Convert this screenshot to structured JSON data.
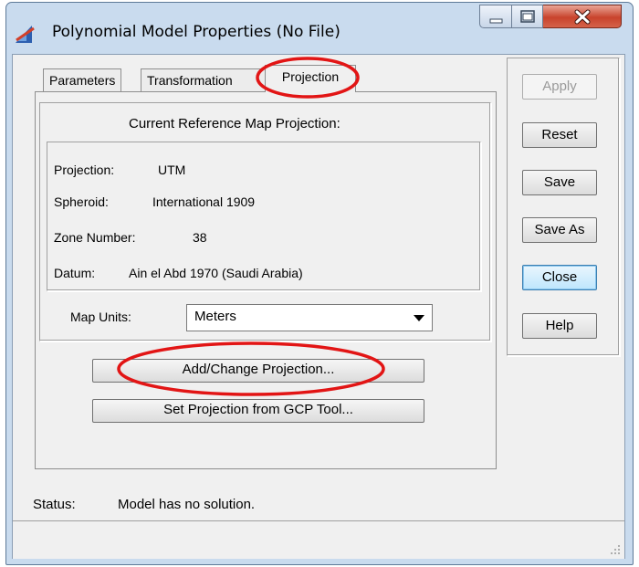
{
  "window": {
    "title": "Polynomial Model Properties (No File)",
    "accent": "#c9dbee",
    "close_color": "#c8432c",
    "annotation_color": "#e21515"
  },
  "tabs": [
    {
      "label": "Parameters"
    },
    {
      "label": "Transformation"
    },
    {
      "label": "Projection",
      "active": true
    }
  ],
  "projection": {
    "heading": "Current Reference Map Projection:",
    "projection_label": "Projection:",
    "projection_value": "UTM",
    "spheroid_label": "Spheroid:",
    "spheroid_value": "International 1909",
    "zone_label": "Zone Number:",
    "zone_value": "38",
    "datum_label": "Datum:",
    "datum_value": "Ain el Abd 1970 (Saudi Arabia)",
    "map_units_label": "Map Units:",
    "map_units_value": "Meters",
    "add_change_button": "Add/Change Projection...",
    "set_from_gcp_button": "Set Projection from GCP Tool..."
  },
  "side_buttons": {
    "apply": "Apply",
    "reset": "Reset",
    "save": "Save",
    "save_as": "Save As",
    "close": "Close",
    "help": "Help"
  },
  "status": {
    "label": "Status:",
    "text": "Model has no solution."
  }
}
